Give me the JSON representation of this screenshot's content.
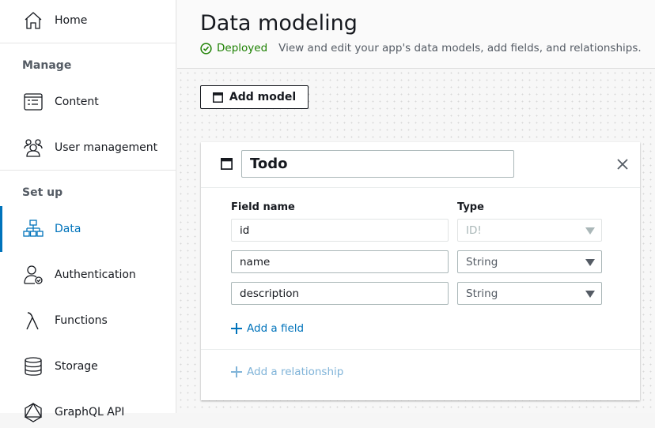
{
  "sidebar": {
    "home": "Home",
    "manage_heading": "Manage",
    "content": "Content",
    "user_management": "User management",
    "setup_heading": "Set up",
    "data": "Data",
    "authentication": "Authentication",
    "functions": "Functions",
    "storage": "Storage",
    "graphql_api": "GraphQL API"
  },
  "header": {
    "title": "Data modeling",
    "status": "Deployed",
    "description": "View and edit your app's data models, add fields, and relationships."
  },
  "toolbar": {
    "add_model": "Add model"
  },
  "model": {
    "name": "Todo",
    "field_name_header": "Field name",
    "type_header": "Type",
    "fields": [
      {
        "name": "id",
        "type": "ID!"
      },
      {
        "name": "name",
        "type": "String"
      },
      {
        "name": "description",
        "type": "String"
      }
    ],
    "add_field": "Add a field",
    "add_relationship": "Add a relationship"
  },
  "colors": {
    "accent": "#0073bb",
    "success": "#1d8102"
  }
}
